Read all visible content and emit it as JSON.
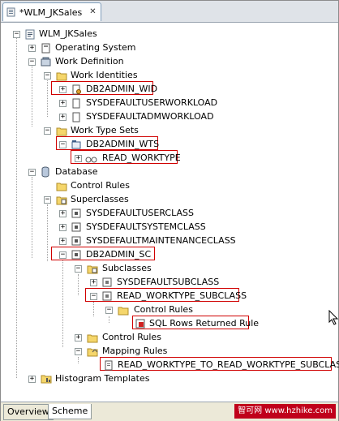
{
  "tab": {
    "title": "*WLM_JKSales",
    "close": "✕"
  },
  "tree": {
    "root": "WLM_JKSales",
    "operating_system": "Operating System",
    "work_definition": "Work Definition",
    "work_identities": "Work Identities",
    "db2admin_wid": "DB2ADMIN_WID",
    "sysdefault_user_workload": "SYSDEFAULTUSERWORKLOAD",
    "sysdefault_adm_workload": "SYSDEFAULTADMWORKLOAD",
    "work_type_sets": "Work Type Sets",
    "db2admin_wts": "DB2ADMIN_WTS",
    "read_worktype": "READ_WORKTYPE",
    "database": "Database",
    "control_rules": "Control Rules",
    "superclasses": "Superclasses",
    "sysdefault_user_class": "SYSDEFAULTUSERCLASS",
    "sysdefault_system_class": "SYSDEFAULTSYSTEMCLASS",
    "sysdefault_maintenance_class": "SYSDEFAULTMAINTENANCECLASS",
    "db2admin_sc": "DB2ADMIN_SC",
    "subclasses": "Subclasses",
    "sysdefault_subclass": "SYSDEFAULTSUBCLASS",
    "read_worktype_subclass": "READ_WORKTYPE_SUBCLASS",
    "sub_control_rules": "Control Rules",
    "sql_rows_returned_rule": "SQL Rows Returned Rule",
    "sc_control_rules": "Control Rules",
    "mapping_rules": "Mapping Rules",
    "mapping_rule_item": "READ_WORKTYPE_TO_READ_WORKTYPE_SUBCLASS",
    "histogram_templates": "Histogram Templates"
  },
  "bottom_tabs": {
    "overview": "Overview",
    "scheme": "Scheme"
  },
  "watermark": "智可网 www.hzhike.com",
  "colors": {
    "highlight": "#d00000",
    "folder": "#f5d66b",
    "tab_border": "#7f9db9"
  }
}
